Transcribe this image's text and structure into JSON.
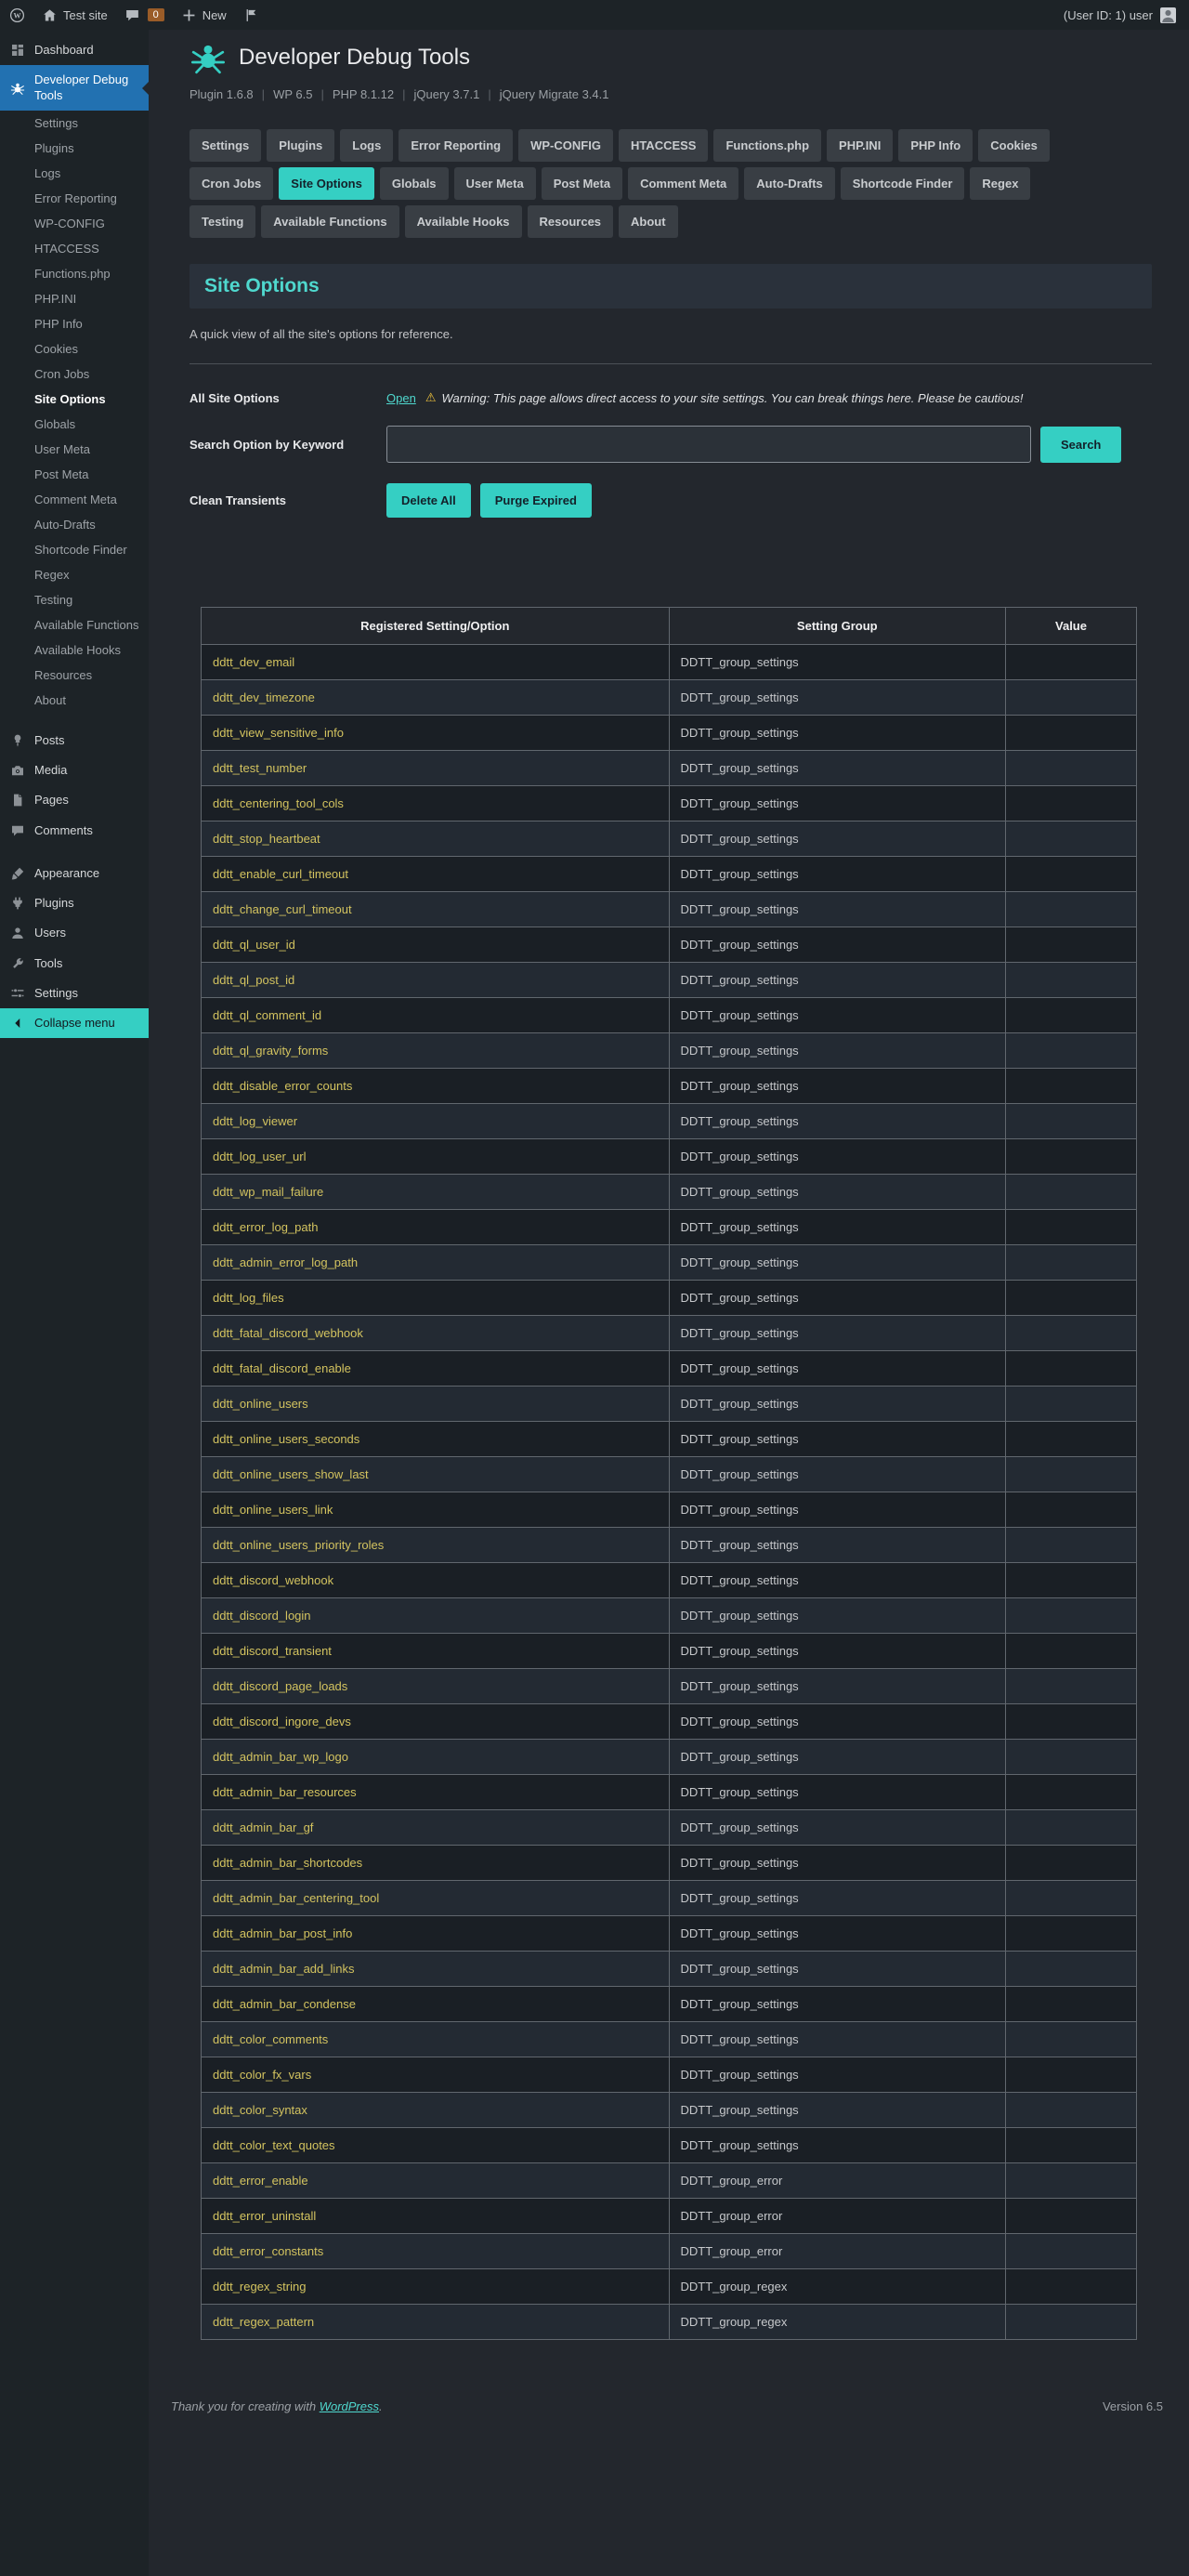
{
  "colors": {
    "accent_teal": "#35cfc3",
    "active_menu_blue": "#2271b1",
    "option_name_yellow": "#d3c35f",
    "warning_yellow": "#f0c33c"
  },
  "admin_bar": {
    "site_name": "Test site",
    "comments_count": "0",
    "new_label": "New",
    "user_text": "(User ID: 1) user"
  },
  "sidebar": {
    "items": [
      {
        "type": "top",
        "icon": "dashboard-icon",
        "label": "Dashboard"
      },
      {
        "type": "top",
        "icon": "bug-icon",
        "label": "Developer Debug Tools",
        "active": true
      },
      {
        "type": "sub",
        "label": "Settings"
      },
      {
        "type": "sub",
        "label": "Plugins"
      },
      {
        "type": "sub",
        "label": "Logs"
      },
      {
        "type": "sub",
        "label": "Error Reporting"
      },
      {
        "type": "sub",
        "label": "WP-CONFIG"
      },
      {
        "type": "sub",
        "label": "HTACCESS"
      },
      {
        "type": "sub",
        "label": "Functions.php"
      },
      {
        "type": "sub",
        "label": "PHP.INI"
      },
      {
        "type": "sub",
        "label": "PHP Info"
      },
      {
        "type": "sub",
        "label": "Cookies"
      },
      {
        "type": "sub",
        "label": "Cron Jobs"
      },
      {
        "type": "sub",
        "label": "Site Options",
        "current": true
      },
      {
        "type": "sub",
        "label": "Globals"
      },
      {
        "type": "sub",
        "label": "User Meta"
      },
      {
        "type": "sub",
        "label": "Post Meta"
      },
      {
        "type": "sub",
        "label": "Comment Meta"
      },
      {
        "type": "sub",
        "label": "Auto-Drafts"
      },
      {
        "type": "sub",
        "label": "Shortcode Finder"
      },
      {
        "type": "sub",
        "label": "Regex"
      },
      {
        "type": "sub",
        "label": "Testing"
      },
      {
        "type": "sub",
        "label": "Available Functions"
      },
      {
        "type": "sub",
        "label": "Available Hooks"
      },
      {
        "type": "sub",
        "label": "Resources"
      },
      {
        "type": "sub",
        "label": "About"
      },
      {
        "type": "sep"
      },
      {
        "type": "top",
        "icon": "pin-icon",
        "label": "Posts"
      },
      {
        "type": "top",
        "icon": "camera-icon",
        "label": "Media"
      },
      {
        "type": "top",
        "icon": "pages-icon",
        "label": "Pages"
      },
      {
        "type": "top",
        "icon": "comments-icon",
        "label": "Comments"
      },
      {
        "type": "sep"
      },
      {
        "type": "top",
        "icon": "appearance-icon",
        "label": "Appearance"
      },
      {
        "type": "top",
        "icon": "plugins-icon",
        "label": "Plugins"
      },
      {
        "type": "top",
        "icon": "users-icon",
        "label": "Users"
      },
      {
        "type": "top",
        "icon": "tools-icon",
        "label": "Tools"
      },
      {
        "type": "top",
        "icon": "settings-icon",
        "label": "Settings"
      },
      {
        "type": "collapse",
        "icon": "collapse-icon",
        "label": "Collapse menu"
      }
    ]
  },
  "header": {
    "title": "Developer Debug Tools",
    "meta_segments": [
      "Plugin 1.6.8",
      "WP 6.5",
      "PHP 8.1.12",
      "jQuery 3.7.1",
      "jQuery Migrate 3.4.1"
    ]
  },
  "tabs": {
    "rows": [
      [
        {
          "label": "Settings"
        },
        {
          "label": "Plugins"
        },
        {
          "label": "Logs"
        },
        {
          "label": "Error Reporting"
        },
        {
          "label": "WP-CONFIG"
        },
        {
          "label": "HTACCESS"
        },
        {
          "label": "Functions.php"
        },
        {
          "label": "PHP.INI"
        },
        {
          "label": "PHP Info"
        },
        {
          "label": "Cookies"
        }
      ],
      [
        {
          "label": "Cron Jobs"
        },
        {
          "label": "Site Options",
          "active": true
        },
        {
          "label": "Globals"
        },
        {
          "label": "User Meta"
        },
        {
          "label": "Post Meta"
        },
        {
          "label": "Comment Meta"
        },
        {
          "label": "Auto-Drafts"
        },
        {
          "label": "Shortcode Finder"
        },
        {
          "label": "Regex"
        }
      ],
      [
        {
          "label": "Testing"
        },
        {
          "label": "Available Functions"
        },
        {
          "label": "Available Hooks"
        },
        {
          "label": "Resources"
        },
        {
          "label": "About"
        }
      ]
    ]
  },
  "page": {
    "section_title": "Site Options",
    "description": "A quick view of all the site's options for reference.",
    "all_site_options_label": "All Site Options",
    "open_link": "Open",
    "warning_icon": "⚠",
    "warning_text": "Warning: This page allows direct access to your site settings. You can break things here. Please be cautious!",
    "search_label": "Search Option by Keyword",
    "search_value": "",
    "search_button": "Search",
    "clean_transients_label": "Clean Transients",
    "delete_all_button": "Delete All",
    "purge_expired_button": "Purge Expired"
  },
  "table": {
    "headers": [
      "Registered Setting/Option",
      "Setting Group",
      "Value"
    ],
    "rows": [
      [
        "ddtt_dev_email",
        "DDTT_group_settings",
        ""
      ],
      [
        "ddtt_dev_timezone",
        "DDTT_group_settings",
        ""
      ],
      [
        "ddtt_view_sensitive_info",
        "DDTT_group_settings",
        ""
      ],
      [
        "ddtt_test_number",
        "DDTT_group_settings",
        ""
      ],
      [
        "ddtt_centering_tool_cols",
        "DDTT_group_settings",
        ""
      ],
      [
        "ddtt_stop_heartbeat",
        "DDTT_group_settings",
        ""
      ],
      [
        "ddtt_enable_curl_timeout",
        "DDTT_group_settings",
        ""
      ],
      [
        "ddtt_change_curl_timeout",
        "DDTT_group_settings",
        ""
      ],
      [
        "ddtt_ql_user_id",
        "DDTT_group_settings",
        ""
      ],
      [
        "ddtt_ql_post_id",
        "DDTT_group_settings",
        ""
      ],
      [
        "ddtt_ql_comment_id",
        "DDTT_group_settings",
        ""
      ],
      [
        "ddtt_ql_gravity_forms",
        "DDTT_group_settings",
        ""
      ],
      [
        "ddtt_disable_error_counts",
        "DDTT_group_settings",
        ""
      ],
      [
        "ddtt_log_viewer",
        "DDTT_group_settings",
        ""
      ],
      [
        "ddtt_log_user_url",
        "DDTT_group_settings",
        ""
      ],
      [
        "ddtt_wp_mail_failure",
        "DDTT_group_settings",
        ""
      ],
      [
        "ddtt_error_log_path",
        "DDTT_group_settings",
        ""
      ],
      [
        "ddtt_admin_error_log_path",
        "DDTT_group_settings",
        ""
      ],
      [
        "ddtt_log_files",
        "DDTT_group_settings",
        ""
      ],
      [
        "ddtt_fatal_discord_webhook",
        "DDTT_group_settings",
        ""
      ],
      [
        "ddtt_fatal_discord_enable",
        "DDTT_group_settings",
        ""
      ],
      [
        "ddtt_online_users",
        "DDTT_group_settings",
        ""
      ],
      [
        "ddtt_online_users_seconds",
        "DDTT_group_settings",
        ""
      ],
      [
        "ddtt_online_users_show_last",
        "DDTT_group_settings",
        ""
      ],
      [
        "ddtt_online_users_link",
        "DDTT_group_settings",
        ""
      ],
      [
        "ddtt_online_users_priority_roles",
        "DDTT_group_settings",
        ""
      ],
      [
        "ddtt_discord_webhook",
        "DDTT_group_settings",
        ""
      ],
      [
        "ddtt_discord_login",
        "DDTT_group_settings",
        ""
      ],
      [
        "ddtt_discord_transient",
        "DDTT_group_settings",
        ""
      ],
      [
        "ddtt_discord_page_loads",
        "DDTT_group_settings",
        ""
      ],
      [
        "ddtt_discord_ingore_devs",
        "DDTT_group_settings",
        ""
      ],
      [
        "ddtt_admin_bar_wp_logo",
        "DDTT_group_settings",
        ""
      ],
      [
        "ddtt_admin_bar_resources",
        "DDTT_group_settings",
        ""
      ],
      [
        "ddtt_admin_bar_gf",
        "DDTT_group_settings",
        ""
      ],
      [
        "ddtt_admin_bar_shortcodes",
        "DDTT_group_settings",
        ""
      ],
      [
        "ddtt_admin_bar_centering_tool",
        "DDTT_group_settings",
        ""
      ],
      [
        "ddtt_admin_bar_post_info",
        "DDTT_group_settings",
        ""
      ],
      [
        "ddtt_admin_bar_add_links",
        "DDTT_group_settings",
        ""
      ],
      [
        "ddtt_admin_bar_condense",
        "DDTT_group_settings",
        ""
      ],
      [
        "ddtt_color_comments",
        "DDTT_group_settings",
        ""
      ],
      [
        "ddtt_color_fx_vars",
        "DDTT_group_settings",
        ""
      ],
      [
        "ddtt_color_syntax",
        "DDTT_group_settings",
        ""
      ],
      [
        "ddtt_color_text_quotes",
        "DDTT_group_settings",
        ""
      ],
      [
        "ddtt_error_enable",
        "DDTT_group_error",
        ""
      ],
      [
        "ddtt_error_uninstall",
        "DDTT_group_error",
        ""
      ],
      [
        "ddtt_error_constants",
        "DDTT_group_error",
        ""
      ],
      [
        "ddtt_regex_string",
        "DDTT_group_regex",
        ""
      ],
      [
        "ddtt_regex_pattern",
        "DDTT_group_regex",
        ""
      ]
    ]
  },
  "footer": {
    "thanks_prefix": "Thank you for creating with",
    "wordpress_link": "WordPress",
    "suffix": ".",
    "version": "Version 6.5"
  }
}
